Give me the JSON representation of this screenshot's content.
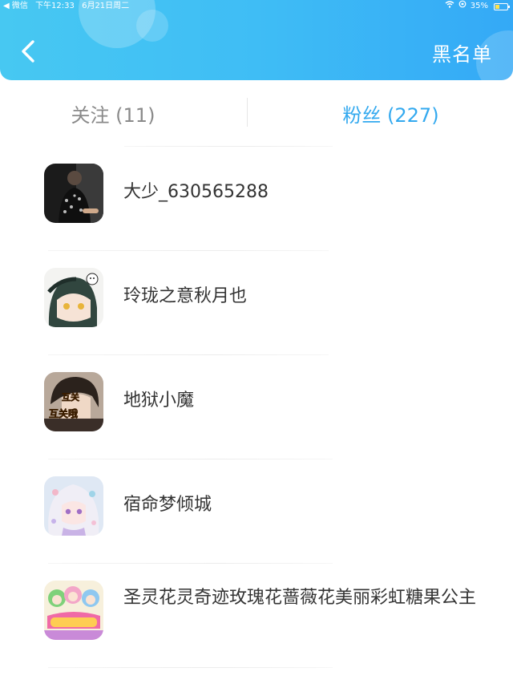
{
  "status_bar": {
    "app": "◀ 微信",
    "time": "下午12:33",
    "date": "6月21日周二",
    "battery": "35%"
  },
  "header": {
    "back_icon": "chevron-left-icon",
    "right_label": "黑名单",
    "gradient": [
      "#47c8f2",
      "#34a9f6"
    ]
  },
  "tabs": [
    {
      "label": "关注 (11)",
      "active": false
    },
    {
      "label": "粉丝 (227)",
      "active": true
    }
  ],
  "accent_color": "#33a9ef",
  "fans": [
    {
      "name": "大少_630565288"
    },
    {
      "name": "玲珑之意秋月也"
    },
    {
      "name": "地狱小魔",
      "avatar_text": [
        "互关",
        "互关哦"
      ]
    },
    {
      "name": "宿命梦倾城"
    },
    {
      "name": "圣灵花灵奇迹玫瑰花蔷薇花美丽彩虹糖果公主"
    }
  ]
}
